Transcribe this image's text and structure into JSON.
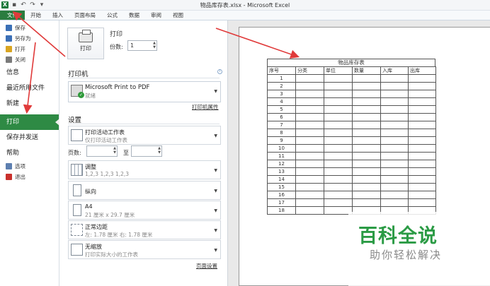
{
  "window": {
    "title": "物品库存表.xlsx - Microsoft Excel"
  },
  "ribbon_tabs": [
    "文件",
    "开始",
    "插入",
    "页面布局",
    "公式",
    "数据",
    "审阅",
    "视图"
  ],
  "nav": {
    "small_top": [
      {
        "label": "保存",
        "color": "#3b6fb6"
      },
      {
        "label": "另存为",
        "color": "#3b6fb6"
      },
      {
        "label": "打开",
        "color": "#d9a521"
      },
      {
        "label": "关闭",
        "color": "#7a7a7a"
      }
    ],
    "big": [
      "信息",
      "最近所用文件",
      "新建",
      "打印",
      "保存并发送",
      "帮助"
    ],
    "active": "打印",
    "small_bottom": [
      {
        "label": "选项",
        "color": "#5d7fb0"
      },
      {
        "label": "退出",
        "color": "#c9302c"
      }
    ]
  },
  "print": {
    "title": "打印",
    "button_label": "打印",
    "copies_label": "份数:",
    "copies_value": "1"
  },
  "printer": {
    "section": "打印机",
    "name": "Microsoft Print to PDF",
    "status": "就绪",
    "properties_link": "打印机属性"
  },
  "settings": {
    "section": "设置",
    "active_sheets": {
      "title": "打印活动工作表",
      "sub": "仅打印活动工作表"
    },
    "pages_label": "页数:",
    "to_label": "至",
    "collate": {
      "title": "调整",
      "sub": "1,2,3    1,2,3    1,2,3"
    },
    "orientation": {
      "title": "纵向"
    },
    "paper": {
      "title": "A4",
      "sub": "21 厘米 x 29.7 厘米"
    },
    "margins": {
      "title": "正常边距",
      "sub": "左: 1.78 厘米    右: 1.78 厘米"
    },
    "scaling": {
      "title": "无缩放",
      "sub": "打印实际大小的工作表"
    },
    "page_setup_link": "页面设置"
  },
  "sheet": {
    "title": "物品库存表",
    "headers": [
      "序号",
      "分类",
      "单位",
      "数量",
      "入库",
      "出库"
    ],
    "row_numbers": [
      "1",
      "2",
      "3",
      "4",
      "5",
      "6",
      "7",
      "8",
      "9",
      "10",
      "11",
      "12",
      "13",
      "14",
      "15",
      "16",
      "17",
      "18"
    ]
  },
  "watermark": {
    "logo": "百科全说",
    "sub": "助你轻松解决"
  },
  "colors": {
    "accent_green": "#2e8a44",
    "arrow_red": "#e03a3a"
  }
}
